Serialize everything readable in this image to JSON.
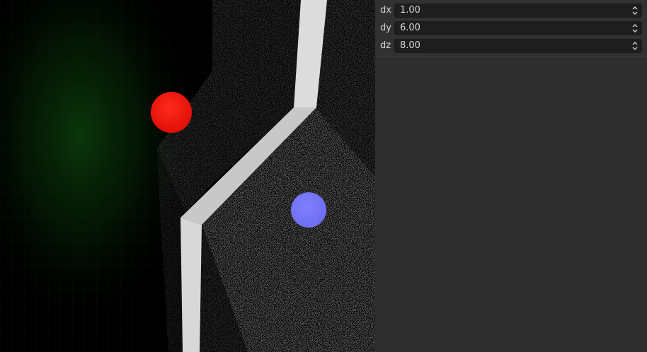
{
  "viewport": {
    "spheres": [
      {
        "name": "red-sphere",
        "color": "#ff1a10"
      },
      {
        "name": "blue-sphere",
        "color": "#7b7bff"
      }
    ],
    "background_glow_color": "#0b3a0b"
  },
  "panel": {
    "fields": [
      {
        "label": "dx",
        "value": "1.00"
      },
      {
        "label": "dy",
        "value": "6.00"
      },
      {
        "label": "dz",
        "value": "8.00"
      }
    ],
    "spinner_icon": "up-down-chevron-icon"
  }
}
